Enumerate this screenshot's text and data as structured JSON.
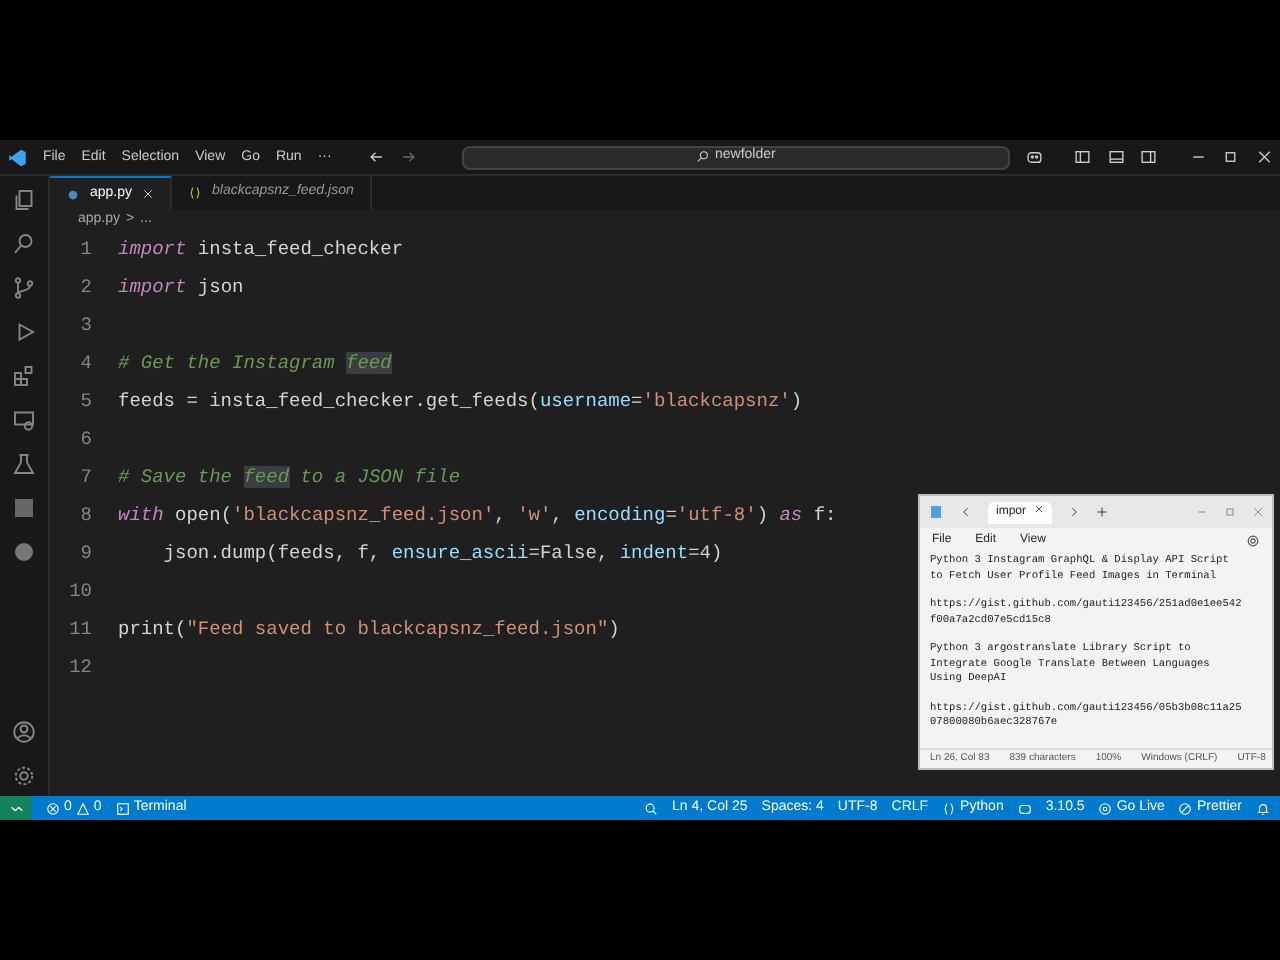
{
  "title_bar": {
    "menu": [
      "File",
      "Edit",
      "Selection",
      "View",
      "Go",
      "Run",
      "···"
    ],
    "search": "newfolder"
  },
  "tabs": [
    {
      "label": "app.py",
      "selected": true,
      "preview": false
    },
    {
      "label": "blackcapsnz_feed.json",
      "selected": false,
      "preview": true
    }
  ],
  "breadcrumb": [
    "app.py",
    ">",
    "..."
  ],
  "editor": {
    "lines": [
      {
        "number": "1",
        "tokens": [
          {
            "kind": "keyword",
            "text": "import"
          },
          {
            "kind": "plain",
            "text": " insta_feed_checker"
          }
        ]
      },
      {
        "number": "2",
        "tokens": [
          {
            "kind": "keyword",
            "text": "import"
          },
          {
            "kind": "plain",
            "text": " json"
          }
        ]
      },
      {
        "number": "3"
      },
      {
        "number": "4",
        "tokens": [
          {
            "kind": "comment",
            "text": "# Get the Instagram "
          },
          {
            "kind": "comment",
            "text": "feed",
            "highlight": true
          }
        ]
      },
      {
        "number": "5",
        "tokens": [
          {
            "kind": "plain",
            "text": "feeds = insta_feed_checker.get_feeds("
          },
          {
            "kind": "param",
            "text": "username"
          },
          {
            "kind": "plain",
            "text": "="
          },
          {
            "kind": "string",
            "text": "'blackcapsnz'"
          },
          {
            "kind": "plain",
            "text": ")"
          }
        ]
      },
      {
        "number": "6"
      },
      {
        "number": "7",
        "tokens": [
          {
            "kind": "comment",
            "text": "# Save the "
          },
          {
            "kind": "comment",
            "text": "feed",
            "highlight": true
          },
          {
            "kind": "comment",
            "text": " to a JSON file"
          }
        ]
      },
      {
        "number": "8",
        "tokens": [
          {
            "kind": "keyword",
            "text": "with"
          },
          {
            "kind": "plain",
            "text": " open("
          },
          {
            "kind": "string",
            "text": "'blackcapsnz_feed.json'"
          },
          {
            "kind": "plain",
            "text": ", "
          },
          {
            "kind": "string",
            "text": "'w'"
          },
          {
            "kind": "plain",
            "text": ", "
          },
          {
            "kind": "param",
            "text": "encoding"
          },
          {
            "kind": "plain",
            "text": "="
          },
          {
            "kind": "string",
            "text": "'utf-8'"
          },
          {
            "kind": "plain",
            "text": ") "
          },
          {
            "kind": "keyword",
            "text": "as"
          },
          {
            "kind": "plain",
            "text": " f:"
          }
        ]
      },
      {
        "number": "9",
        "tokens": [
          {
            "kind": "plain",
            "text": "    json.dump(feeds, f, "
          },
          {
            "kind": "param",
            "text": "ensure_ascii"
          },
          {
            "kind": "plain",
            "text": "=False, "
          },
          {
            "kind": "param",
            "text": "indent"
          },
          {
            "kind": "plain",
            "text": "=4)"
          }
        ]
      },
      {
        "number": "10"
      },
      {
        "number": "11",
        "tokens": [
          {
            "kind": "plain",
            "text": "print("
          },
          {
            "kind": "string",
            "text": "\"Feed saved to blackcapsnz_feed.json\""
          },
          {
            "kind": "plain",
            "text": ")"
          }
        ]
      },
      {
        "number": "12"
      }
    ]
  },
  "notepad": {
    "tab": "impor",
    "menu": [
      "File",
      "Edit",
      "View"
    ],
    "paragraphs": [
      [
        "Python 3 Instagram GraphQL & Display API Script",
        "to Fetch User Profile Feed Images in Terminal"
      ],
      [
        "https://gist.github.com/gauti123456/251ad0e1ee542",
        "f00a7a2cd07e5cd15c8"
      ],
      [
        "Python 3 argostranslate Library Script to",
        "Integrate Google Translate Between Languages",
        "Using DeepAI"
      ],
      [
        "https://gist.github.com/gauti123456/05b3b08c11a25",
        "07800080b6aec328767e"
      ]
    ],
    "status": [
      "Ln 26, Col 83",
      "839 characters",
      "100%",
      "Windows (CRLF)",
      "UTF-8"
    ]
  },
  "status_bar": {
    "errors": "0",
    "warnings": "0",
    "terminal": "Terminal",
    "right": [
      {
        "kind": "icon"
      },
      {
        "kind": "text",
        "text": "Ln 4, Col 25"
      },
      {
        "kind": "text",
        "text": "Spaces: 4"
      },
      {
        "kind": "text",
        "text": "UTF-8"
      },
      {
        "kind": "text",
        "text": "CRLF"
      },
      {
        "kind": "lang",
        "text": "Python"
      },
      {
        "kind": "text",
        "text": "3.10.5"
      },
      {
        "kind": "golive",
        "text": "Go Live"
      },
      {
        "kind": "prettier",
        "text": "Prettier"
      }
    ]
  }
}
